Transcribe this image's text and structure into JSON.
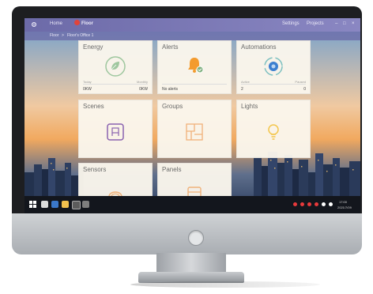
{
  "app": {
    "nav_home": "Home",
    "nav_home_badge": "",
    "nav_floor": "Floor",
    "settings": "Settings",
    "projects": "Projects",
    "breadcrumb_root": "Floor",
    "breadcrumb_sep": ">",
    "breadcrumb_current": "Floor's Office 1"
  },
  "tiles": {
    "energy": {
      "title": "Energy",
      "left_label": "Today",
      "left_value": "0KW",
      "right_label": "Monthly",
      "right_value": "0KW"
    },
    "alerts": {
      "title": "Alerts",
      "status": "No alerts"
    },
    "automations": {
      "title": "Automations",
      "left_label": "Active",
      "left_value": "2",
      "right_label": "Paused",
      "right_value": "0"
    },
    "scenes": {
      "title": "Scenes"
    },
    "groups": {
      "title": "Groups"
    },
    "lights": {
      "title": "Lights"
    },
    "sensors": {
      "title": "Sensors"
    },
    "panels": {
      "title": "Panels"
    }
  },
  "taskbar": {
    "time": "17:00",
    "date": "2021/7/09"
  },
  "colors": {
    "header": "#7d7bbd",
    "accent_orange": "#f39b2e",
    "accent_purple": "#8a62b0",
    "accent_green": "#7fb07f"
  }
}
